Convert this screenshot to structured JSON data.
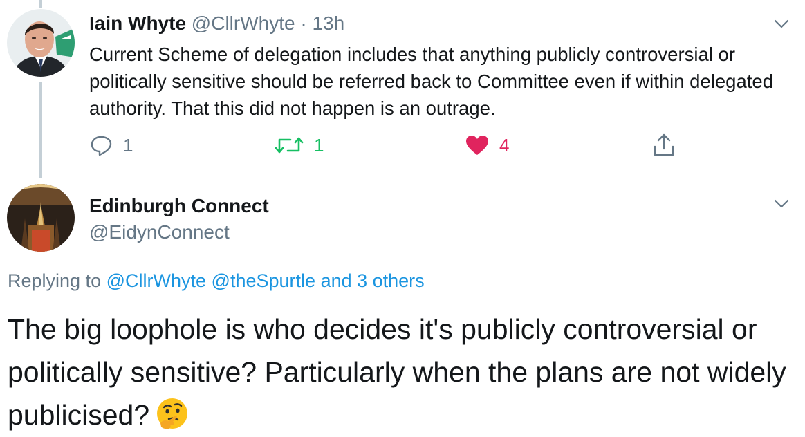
{
  "tweet1": {
    "author_name": "Iain Whyte",
    "handle": "@CllrWhyte",
    "separator": "·",
    "time": "13h",
    "text": "Current Scheme of delegation includes that anything publicly controversial or politically sensitive should be referred back to Committee even if within delegated authority. That this did not happen is an outrage.",
    "actions": {
      "reply_icon": "speech-bubble-icon",
      "reply_count": "1",
      "retweet_icon": "retweet-arrows-icon",
      "retweet_count": "1",
      "like_icon": "heart-icon",
      "like_count": "4",
      "share_icon": "share-upload-icon"
    },
    "menu_icon": "chevron-down-icon"
  },
  "tweet2": {
    "author_name": "Edinburgh Connect",
    "handle": "@EidynConnect",
    "menu_icon": "chevron-down-icon",
    "replying_prefix": "Replying to",
    "replying_to_1": "@CllrWhyte",
    "replying_to_2": "@theSpurtle",
    "replying_others": "and 3 others",
    "text": "The big loophole is who decides it's publicly controversial or politically sensitive? Particularly when the plans are not widely publicised?",
    "emoji": "thinking-face-emoji"
  },
  "colors": {
    "text": "#14171a",
    "secondary": "#657786",
    "link": "#1b95e0",
    "retweet": "#17bf63",
    "like": "#e0245e",
    "thread_line": "#c4cfd6"
  }
}
